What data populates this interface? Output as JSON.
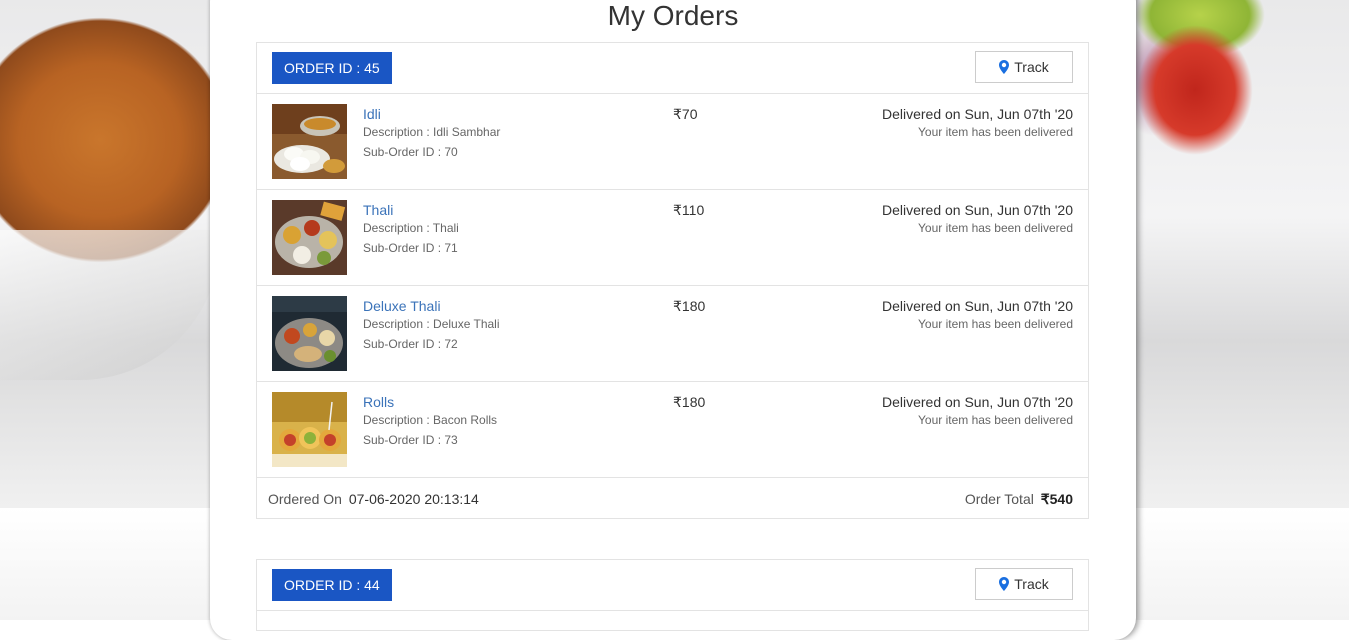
{
  "page": {
    "title": "My Orders"
  },
  "colors": {
    "accent": "#1a56c4",
    "link": "#3b73b9"
  },
  "orders": [
    {
      "order_id_label": "ORDER ID : 45",
      "track_label": "Track",
      "items": [
        {
          "name": "Idli",
          "description": "Description : Idli Sambhar",
          "sub_order": "Sub-Order ID : 70",
          "price": "₹70",
          "status": "Delivered on Sun, Jun 07th '20",
          "status_detail": "Your item has been delivered",
          "thumb_icon": "idli-photo"
        },
        {
          "name": "Thali",
          "description": "Description : Thali",
          "sub_order": "Sub-Order ID : 71",
          "price": "₹110",
          "status": "Delivered on Sun, Jun 07th '20",
          "status_detail": "Your item has been delivered",
          "thumb_icon": "thali-photo"
        },
        {
          "name": "Deluxe Thali",
          "description": "Description : Deluxe Thali",
          "sub_order": "Sub-Order ID : 72",
          "price": "₹180",
          "status": "Delivered on Sun, Jun 07th '20",
          "status_detail": "Your item has been delivered",
          "thumb_icon": "deluxe-thali-photo"
        },
        {
          "name": "Rolls",
          "description": "Description : Bacon Rolls",
          "sub_order": "Sub-Order ID : 73",
          "price": "₹180",
          "status": "Delivered on Sun, Jun 07th '20",
          "status_detail": "Your item has been delivered",
          "thumb_icon": "rolls-photo"
        }
      ],
      "ordered_on_label": "Ordered On",
      "ordered_on_value": "07-06-2020 20:13:14",
      "total_label": "Order Total",
      "total_value": "₹540"
    },
    {
      "order_id_label": "ORDER ID : 44",
      "track_label": "Track"
    }
  ]
}
